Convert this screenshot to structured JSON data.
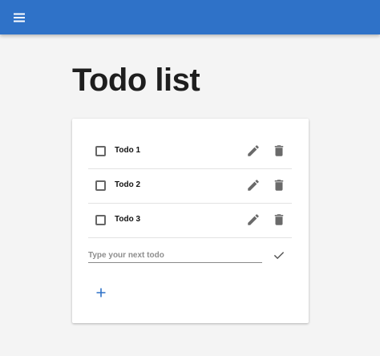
{
  "app_bar": {
    "menu_icon": "menu-icon",
    "color": "#2f72c8"
  },
  "page": {
    "title": "Todo list"
  },
  "todos": [
    {
      "label": "Todo 1"
    },
    {
      "label": "Todo 2"
    },
    {
      "label": "Todo 3"
    }
  ],
  "row_icons": {
    "checkbox": "checkbox-outline-icon",
    "edit": "pencil-icon",
    "delete": "trash-icon"
  },
  "new_todo": {
    "placeholder": "Type your next todo",
    "value": "",
    "confirm_icon": "check-icon"
  },
  "add_button": {
    "icon": "plus-icon",
    "color": "#2f72c8"
  }
}
